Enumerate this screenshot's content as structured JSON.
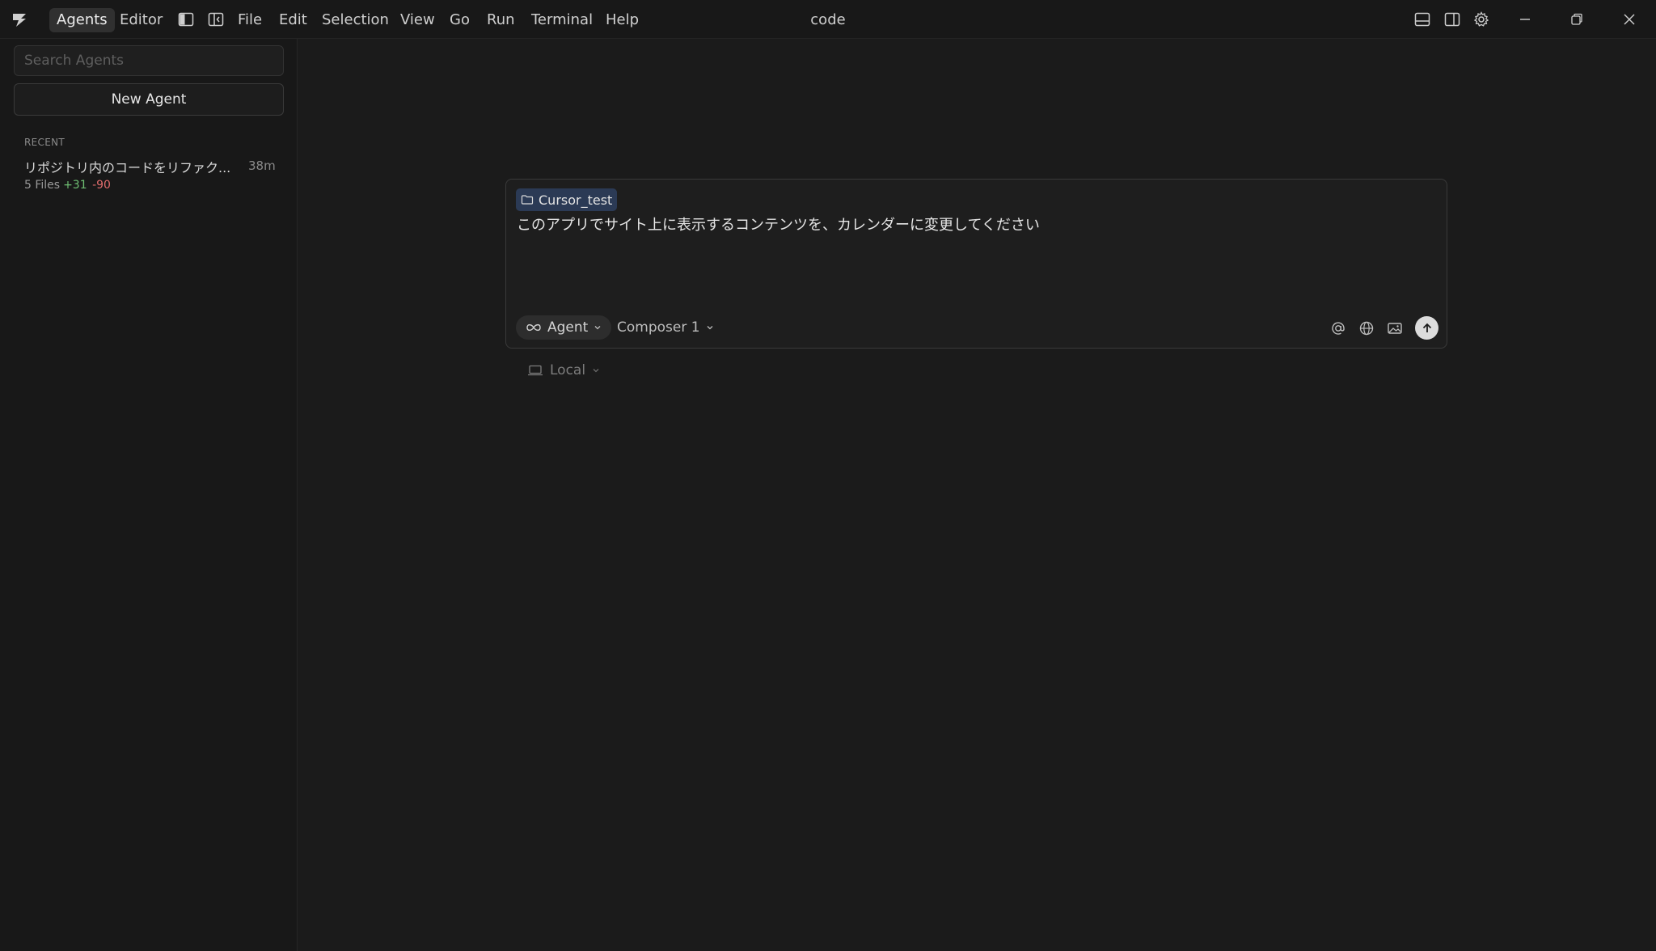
{
  "titlebar": {
    "logo_icon": "cursor-logo-icon",
    "modes": [
      "Agents",
      "Editor"
    ],
    "active_mode": "Agents",
    "menu": [
      "File",
      "Edit",
      "Selection",
      "View",
      "Go",
      "Run",
      "Terminal",
      "Help"
    ],
    "window_title": "code",
    "right_icons": [
      "panel-bottom-icon",
      "panel-right-icon",
      "gear-icon"
    ],
    "window_controls": [
      "minimize-icon",
      "restore-icon",
      "close-icon"
    ]
  },
  "sidebar": {
    "search_placeholder": "Search Agents",
    "new_agent_label": "New Agent",
    "recent_header": "RECENT",
    "recent": [
      {
        "title": "リポジトリ内のコードをリファク...",
        "time": "38m",
        "files": "5 Files",
        "additions": "+31",
        "deletions": "-90"
      }
    ]
  },
  "composer": {
    "folder": "Cursor_test",
    "prompt": "このアプリでサイト上に表示するコンテンツを、カレンダーに変更してください",
    "mode_label": "Agent",
    "model_label": "Composer 1",
    "tool_icons": [
      "at-icon",
      "globe-icon",
      "image-icon",
      "send-arrow-icon"
    ]
  },
  "environment": {
    "label": "Local"
  }
}
